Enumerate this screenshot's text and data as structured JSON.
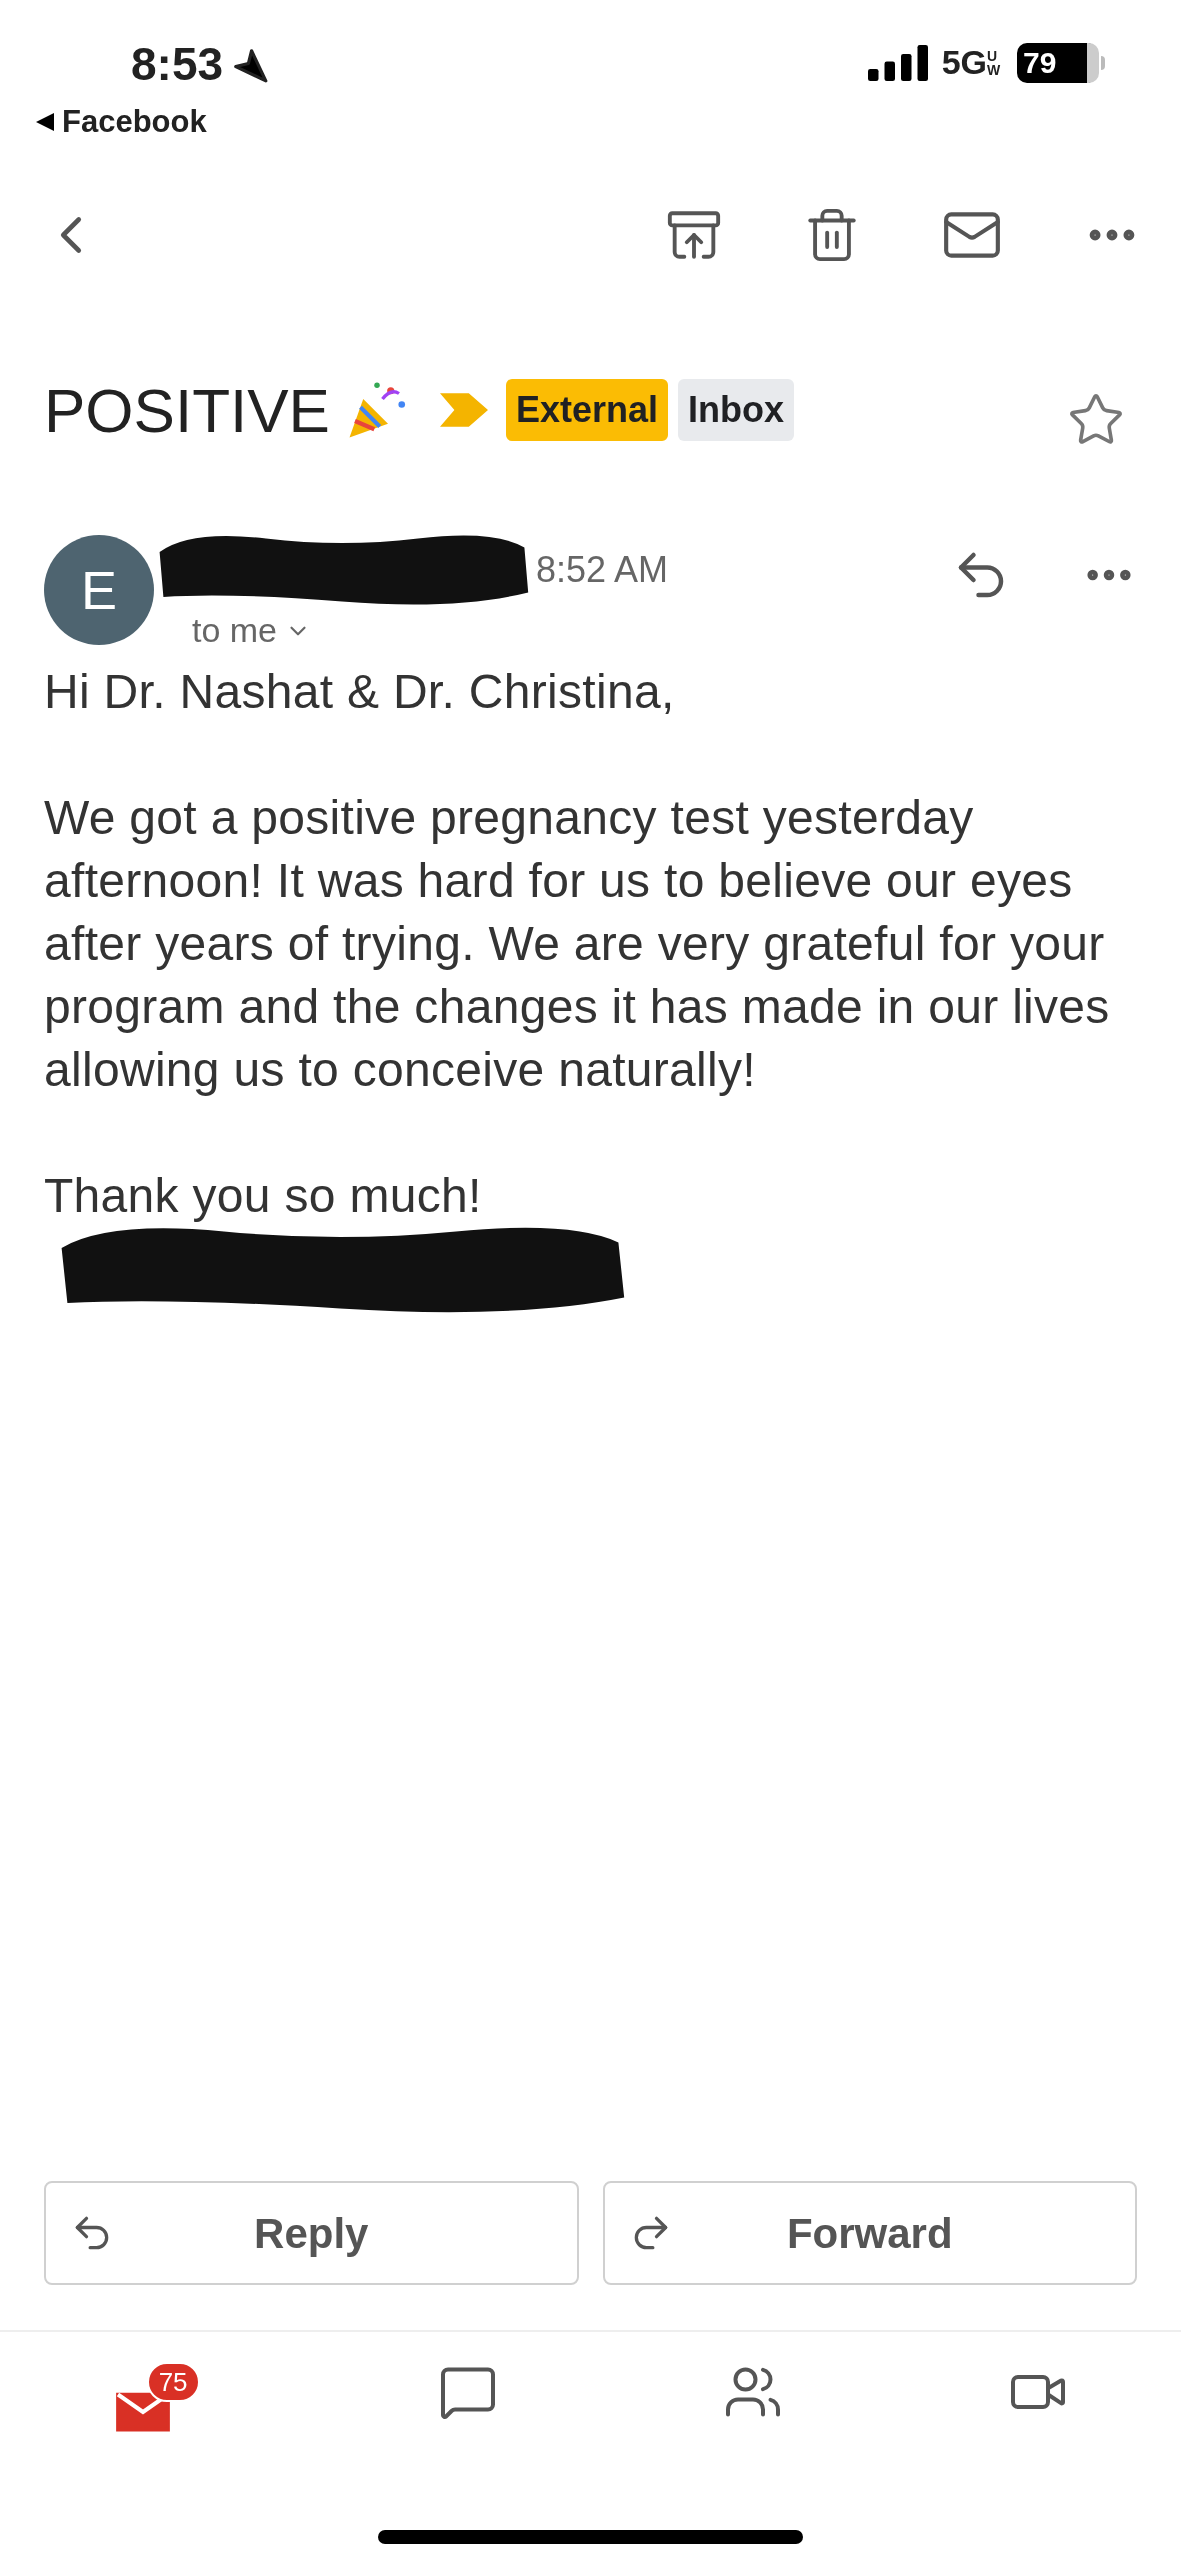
{
  "status_bar": {
    "time": "8:53",
    "back_app": "Facebook",
    "network": "5G",
    "network_sub": "UW",
    "battery": "79"
  },
  "subject": {
    "title": "POSITIVE",
    "important": true,
    "starred": false,
    "labels": [
      {
        "text": "External",
        "kind": "external"
      },
      {
        "text": "Inbox",
        "kind": "inbox"
      }
    ]
  },
  "sender": {
    "initial": "E",
    "time": "8:52 AM",
    "recipient": "to me"
  },
  "body": [
    "Hi Dr. Nashat & Dr. Christina,",
    "We got a positive pregnancy test yesterday afternoon! It was hard for us to believe our eyes after years of trying. We are very grateful for your program and the changes it has made in our lives allowing us to conceive naturally!",
    "Thank you so much!"
  ],
  "actions": [
    {
      "label": "Reply",
      "kind": "reply"
    },
    {
      "label": "Forward",
      "kind": "forward"
    }
  ],
  "nav": [
    {
      "kind": "mail",
      "badge": "75",
      "selected": true
    },
    {
      "kind": "chat",
      "selected": false
    },
    {
      "kind": "spaces",
      "selected": false
    },
    {
      "kind": "meet",
      "selected": false
    }
  ]
}
